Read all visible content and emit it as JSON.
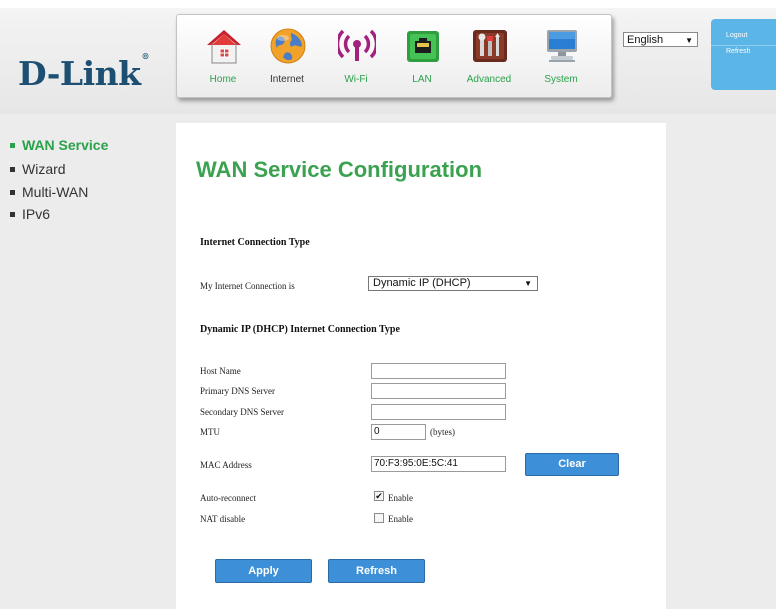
{
  "brand": {
    "logo_text": "D-Link",
    "logo_mark": "®"
  },
  "nav": {
    "items": [
      {
        "label": "Home",
        "icon": "home-icon"
      },
      {
        "label": "Internet",
        "icon": "globe-icon",
        "active": true
      },
      {
        "label": "Wi-Fi",
        "icon": "wifi-icon"
      },
      {
        "label": "LAN",
        "icon": "lan-icon"
      },
      {
        "label": "Advanced",
        "icon": "advanced-tools-icon"
      },
      {
        "label": "System",
        "icon": "computer-icon"
      }
    ]
  },
  "language": {
    "selected": "English"
  },
  "side_actions": {
    "logout": "Logout",
    "refresh": "Refresh"
  },
  "sidebar": {
    "items": [
      {
        "label": "WAN Service",
        "active": true
      },
      {
        "label": "Wizard"
      },
      {
        "label": "Multi-WAN"
      },
      {
        "label": "IPv6"
      }
    ]
  },
  "main": {
    "title": "WAN Service Configuration",
    "section1": {
      "heading": "Internet Connection Type",
      "connection_label": "My Internet Connection is",
      "connection_value": "Dynamic IP (DHCP)"
    },
    "section2": {
      "heading": "Dynamic IP (DHCP) Internet Connection Type",
      "host_name_label": "Host Name",
      "host_name_value": "",
      "primary_dns_label": "Primary DNS Server",
      "primary_dns_value": "",
      "secondary_dns_label": "Secondary DNS Server",
      "secondary_dns_value": "",
      "mtu_label": "MTU",
      "mtu_value": "0",
      "mtu_unit": "(bytes)",
      "mac_label": "MAC Address",
      "mac_value": "70:F3:95:0E:5C:41",
      "clear_label": "Clear",
      "auto_reconnect_label": "Auto-reconnect",
      "auto_reconnect_checked": true,
      "auto_reconnect_enable": "Enable",
      "nat_disable_label": "NAT disable",
      "nat_disable_checked": false,
      "nat_disable_enable": "Enable"
    },
    "apply_label": "Apply",
    "refresh_label": "Refresh"
  },
  "colors": {
    "accent_green": "#3aa250",
    "button_blue": "#3d8fd8",
    "side_panel_blue": "#5bb5e6",
    "logo_blue": "#1d4f73"
  }
}
